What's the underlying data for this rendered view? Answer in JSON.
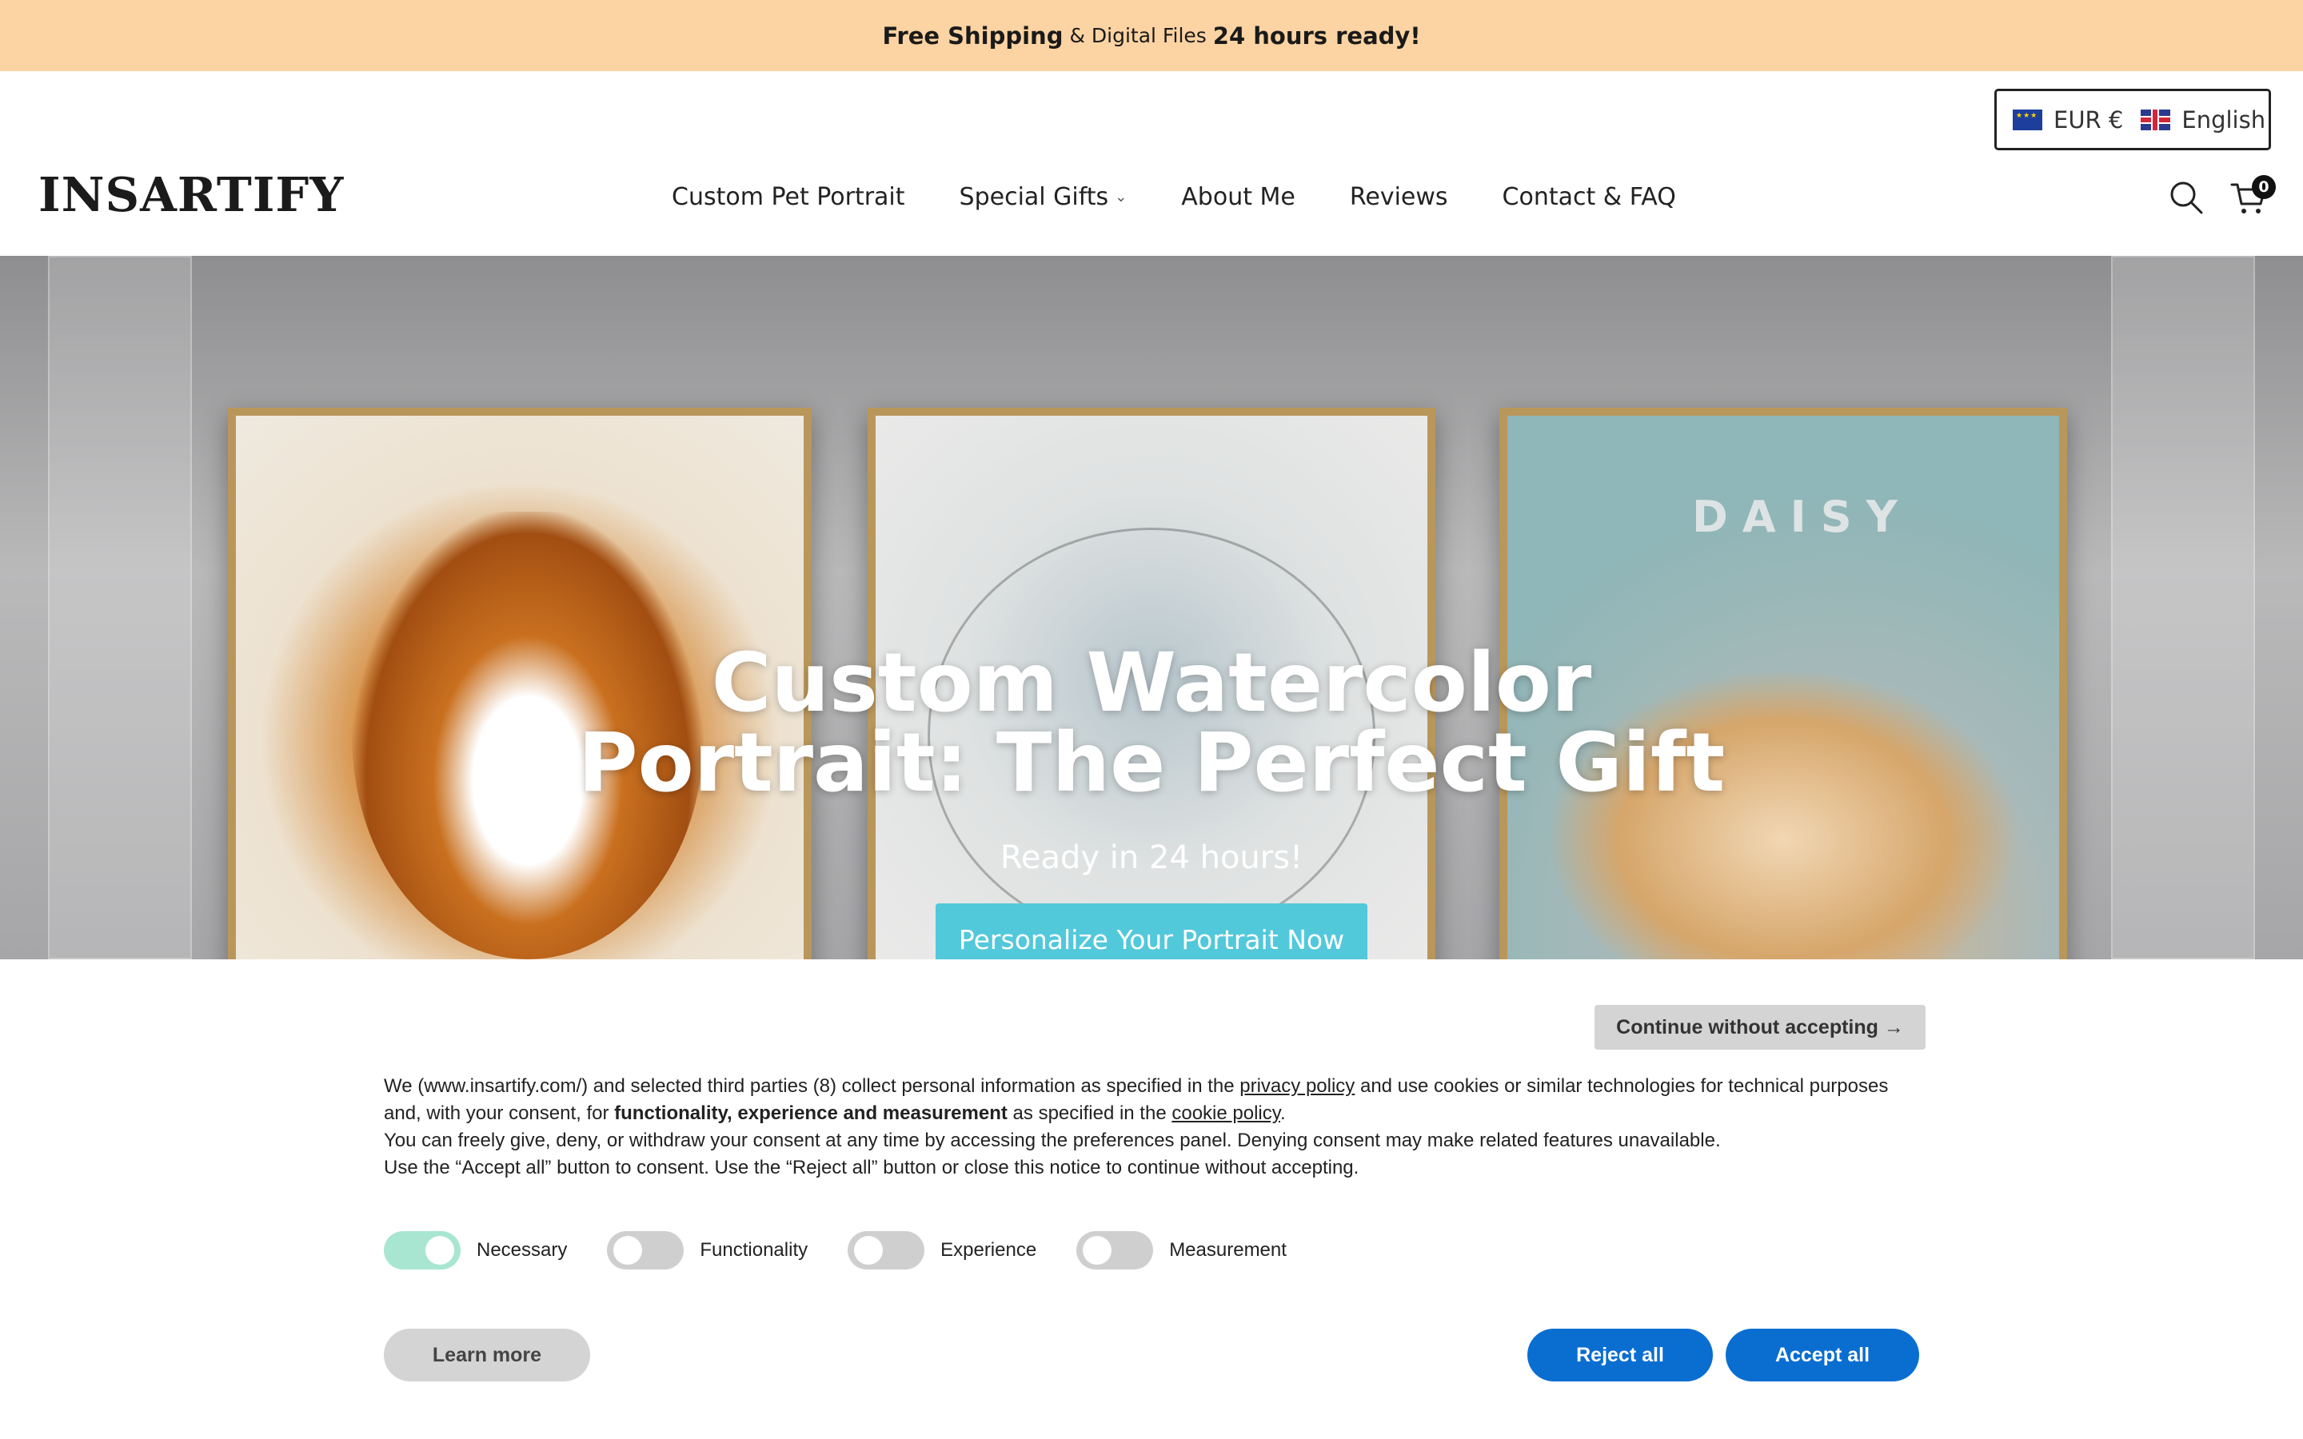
{
  "announcement": {
    "part1": "Free Shipping",
    "part2": "& Digital Files",
    "part3": "24 hours ready!"
  },
  "locale": {
    "currency": "EUR €",
    "language": "English",
    "currency_flag_icon": "eu-flag-icon",
    "language_flag_icon": "uk-flag-icon"
  },
  "brand": {
    "logo": "INSARTIFY"
  },
  "nav": {
    "items": [
      {
        "label": "Custom Pet Portrait"
      },
      {
        "label": "Special Gifts"
      },
      {
        "label": "About Me"
      },
      {
        "label": "Reviews"
      },
      {
        "label": "Contact & FAQ"
      }
    ]
  },
  "header_icons": {
    "search": "search-icon",
    "cart": "cart-icon",
    "cart_count": "0"
  },
  "hero": {
    "title_line1": "Custom Watercolor",
    "title_line2": "Portrait: The Perfect Gift",
    "subtitle": "Ready in 24 hours!",
    "cta": "Personalize Your Portrait Now",
    "frame_name": "DAISY"
  },
  "cookie": {
    "continue": "Continue without accepting →",
    "t1": "We (www.insartify.com/) and selected third parties (8) collect personal information as specified in the",
    "privacy_link": "privacy policy",
    "t2": "and use cookies or similar technologies for technical purposes and, with your consent, for",
    "t2_bold": "functionality, experience and measurement",
    "t3": "as specified in the",
    "cookie_link": "cookie policy",
    "t4": ".",
    "line2": "You can freely give, deny, or withdraw your consent at any time by accessing the preferences panel. Denying consent may make related features unavailable.",
    "line3": "Use the “Accept all” button to consent. Use the “Reject all” button or close this notice to continue without accepting.",
    "toggles": [
      {
        "label": "Necessary",
        "on": true
      },
      {
        "label": "Functionality",
        "on": false
      },
      {
        "label": "Experience",
        "on": false
      },
      {
        "label": "Measurement",
        "on": false
      }
    ],
    "learn_more": "Learn more",
    "reject_all": "Reject all",
    "accept_all": "Accept all"
  }
}
